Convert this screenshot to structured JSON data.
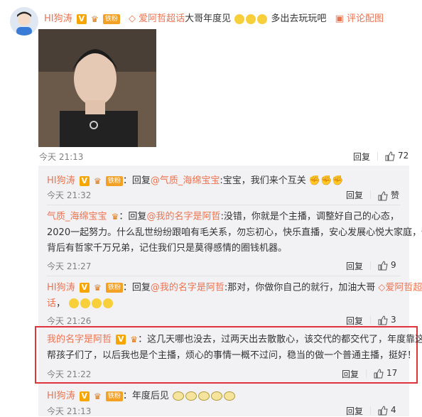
{
  "main_comment": {
    "author": "HI狗涛",
    "fan_badge": "铁粉",
    "topic_link": "爱阿哲超话",
    "text_a": "大哥年度见",
    "text_b": "多出去玩玩吧",
    "rate_link": "评论配图",
    "time": "今天 21:13",
    "reply_label": "回复",
    "likes": "72"
  },
  "replies": [
    {
      "author": "HI狗涛",
      "fan_badge": "铁粉",
      "prefix": "：回复",
      "mention": "@气质_海绵宝宝",
      "text": ":宝宝，我们来个互关",
      "time": "今天 21:32",
      "reply_label": "回复",
      "likes": "赞"
    },
    {
      "author": "气质_海绵宝宝",
      "prefix": "：回复",
      "mention": "@我的名字是阿哲",
      "line1": ":没错，你就是个主播，调整好自己的心态，",
      "line2": "2020一起努力。什么乱世纷纷跟咱有毛关系，勿忘初心，快乐直播，安心发展心悦大家庭，你",
      "line3": "背后有哲家千万兄弟，记住我们只是莫得感情的圈钱机器。",
      "time": "今天 21:27",
      "reply_label": "回复",
      "likes": "9"
    },
    {
      "author": "HI狗涛",
      "fan_badge": "铁粉",
      "prefix": "：回复",
      "mention": "@我的名字是阿哲",
      "text": ":那对，你做你自己的就行，加油大哥",
      "topic_link": "爱阿哲超",
      "topic_link_tail": "话",
      "time": "今天 21:26",
      "reply_label": "回复",
      "likes": "3"
    },
    {
      "author": "我的名字是阿哲",
      "line1": "：这几天哪也没去，过两天出去散散心，该交代的都交代了，年度靠这",
      "line2": "帮孩子们了，以后我也是个主播，烦心的事情一概不过问，稳当的做一个普通主播，挺好！",
      "time": "今天 21:22",
      "reply_label": "回复",
      "likes": "17"
    },
    {
      "author": "HI狗涛",
      "fan_badge": "铁粉",
      "text": "：年度后见",
      "time": "今天 21:13",
      "reply_label": "回复",
      "likes": "4"
    }
  ],
  "colors": {
    "link": "#eb7350",
    "highlight_border": "#e0343c",
    "reply_bg": "#f2f2f5"
  }
}
